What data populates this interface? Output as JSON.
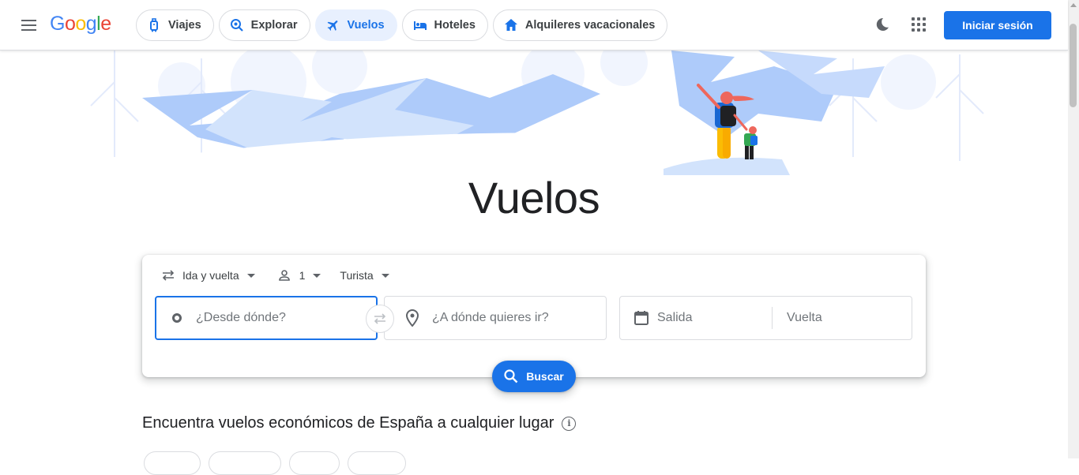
{
  "header": {
    "logo_text": "Google",
    "nav": [
      {
        "label": "Viajes",
        "icon": "suitcase-icon"
      },
      {
        "label": "Explorar",
        "icon": "explore-icon"
      },
      {
        "label": "Vuelos",
        "icon": "airplane-icon",
        "active": true
      },
      {
        "label": "Hoteles",
        "icon": "bed-icon"
      },
      {
        "label": "Alquileres vacacionales",
        "icon": "house-icon"
      }
    ],
    "signin_label": "Iniciar sesión"
  },
  "page_title": "Vuelos",
  "search": {
    "trip_type": "Ida y vuelta",
    "passengers": "1",
    "cabin_class": "Turista",
    "from_placeholder": "¿Desde dónde?",
    "to_placeholder": "¿A dónde quieres ir?",
    "departure_placeholder": "Salida",
    "return_placeholder": "Vuelta",
    "search_label": "Buscar"
  },
  "section_title": "Encuentra vuelos económicos de España a cualquier lugar",
  "colors": {
    "accent": "#1a73e8",
    "active_chip_bg": "#e8f0fe",
    "illustration_blue": "#aecbfa"
  }
}
